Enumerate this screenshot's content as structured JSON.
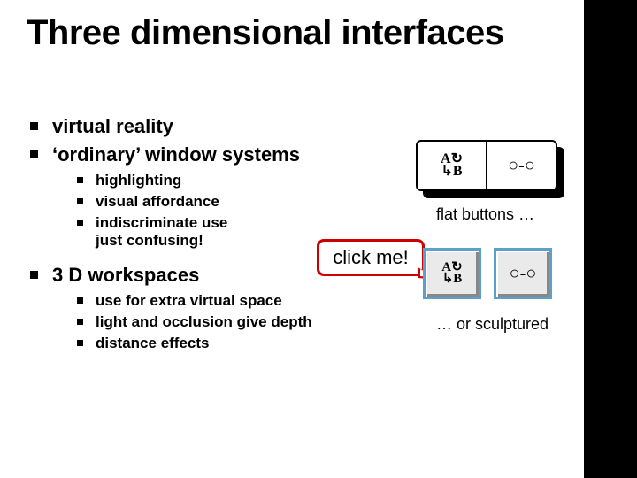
{
  "title": "Three dimensional interfaces",
  "bullets": {
    "b1": "virtual reality",
    "b2": "‘ordinary’ window systems",
    "b2_sub": {
      "s1": "highlighting",
      "s2": "visual affordance",
      "s3": "indiscriminate use",
      "s3b": "just confusing!"
    },
    "b3": "3 D workspaces",
    "b3_sub": {
      "s1": "use for extra virtual space",
      "s2": "light and occlusion give depth",
      "s3": "distance effects"
    }
  },
  "illus": {
    "caption_flat": "flat buttons …",
    "caption_sculpt": "… or sculptured",
    "speech": "click me!",
    "glyph_ab_row1": "A↻",
    "glyph_ab_row2": "↳B",
    "glyph_glasses": "○-○"
  }
}
